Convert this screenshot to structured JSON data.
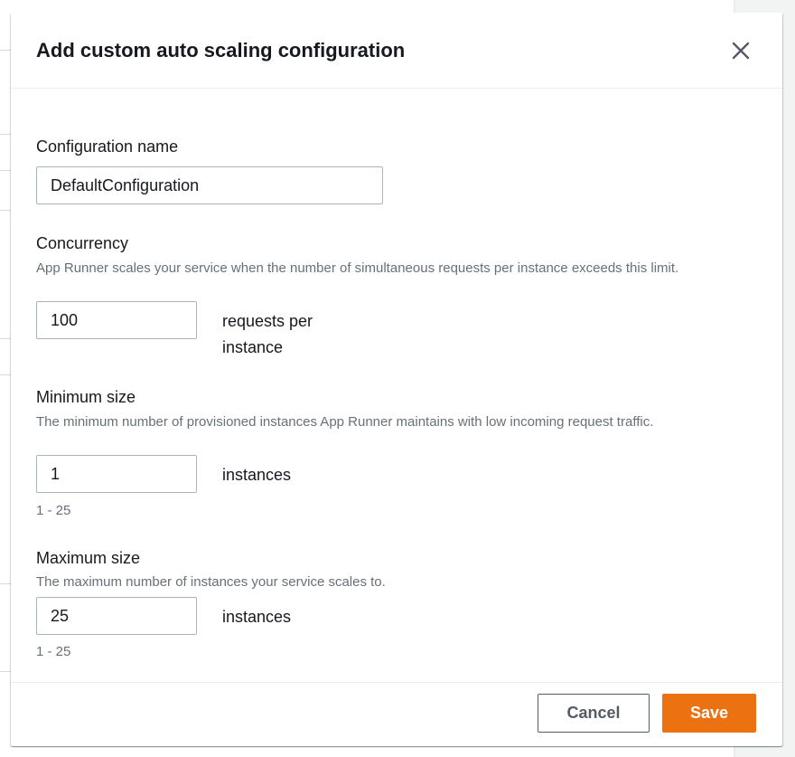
{
  "modal": {
    "title": "Add custom auto scaling configuration",
    "close_icon": "close-icon"
  },
  "fields": {
    "configuration_name": {
      "label": "Configuration name",
      "value": "DefaultConfiguration"
    },
    "concurrency": {
      "label": "Concurrency",
      "description": "App Runner scales your service when the number of simultaneous requests per instance exceeds this limit.",
      "value": "100",
      "unit": "requests per instance"
    },
    "minimum_size": {
      "label": "Minimum size",
      "description": "The minimum number of provisioned instances App Runner maintains with low incoming request traffic.",
      "value": "1",
      "unit": "instances",
      "constraint": "1 - 25"
    },
    "maximum_size": {
      "label": "Maximum size",
      "description": "The maximum number of instances your service scales to.",
      "value": "25",
      "unit": "instances",
      "constraint": "1 - 25"
    }
  },
  "footer": {
    "cancel_label": "Cancel",
    "save_label": "Save"
  },
  "colors": {
    "primary_button": "#ec7211",
    "text": "#16191f",
    "secondary_text": "#687078",
    "input_border": "#aab7b8"
  }
}
